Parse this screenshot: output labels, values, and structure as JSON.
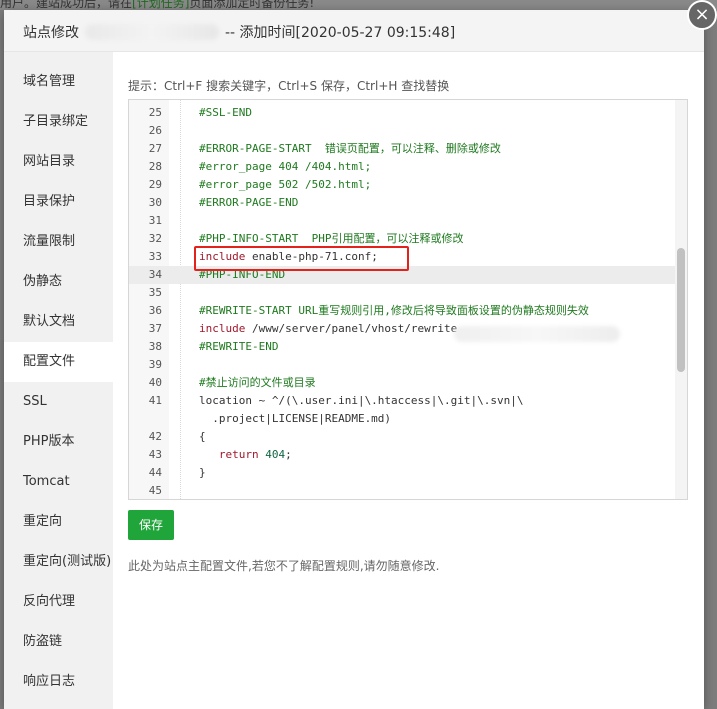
{
  "background": {
    "text_prefix": "用户。建站成功后，请在",
    "text_link": "[计划任务]",
    "text_suffix": "页面添加定时备份任务!"
  },
  "modal": {
    "title_prefix": "站点修改",
    "title_suffix": "-- 添加时间[2020-05-27 09:15:48]",
    "close_icon": "×"
  },
  "sidebar": {
    "items": [
      {
        "label": "域名管理"
      },
      {
        "label": "子目录绑定"
      },
      {
        "label": "网站目录"
      },
      {
        "label": "目录保护"
      },
      {
        "label": "流量限制"
      },
      {
        "label": "伪静态"
      },
      {
        "label": "默认文档"
      },
      {
        "label": "配置文件",
        "active": true
      },
      {
        "label": "SSL"
      },
      {
        "label": "PHP版本"
      },
      {
        "label": "Tomcat"
      },
      {
        "label": "重定向"
      },
      {
        "label": "重定向(测试版)"
      },
      {
        "label": "反向代理"
      },
      {
        "label": "防盗链"
      },
      {
        "label": "响应日志"
      }
    ]
  },
  "content": {
    "tip": "提示：Ctrl+F 搜索关键字，Ctrl+S 保存，Ctrl+H 查找替换",
    "save_label": "保存",
    "note": "此处为站点主配置文件,若您不了解配置规则,请勿随意修改."
  },
  "editor": {
    "lines": [
      {
        "n": "25",
        "parts": [
          {
            "t": "#SSL-END",
            "c": "comment"
          }
        ]
      },
      {
        "n": "26",
        "parts": []
      },
      {
        "n": "27",
        "parts": [
          {
            "t": "#ERROR-PAGE-START  错误页配置，可以注释、删除或修改",
            "c": "comment"
          }
        ]
      },
      {
        "n": "28",
        "parts": [
          {
            "t": "#error_page 404 /404.html;",
            "c": "comment"
          }
        ]
      },
      {
        "n": "29",
        "parts": [
          {
            "t": "#error_page 502 /502.html;",
            "c": "comment"
          }
        ]
      },
      {
        "n": "30",
        "parts": [
          {
            "t": "#ERROR-PAGE-END",
            "c": "comment"
          }
        ]
      },
      {
        "n": "31",
        "parts": []
      },
      {
        "n": "32",
        "parts": [
          {
            "t": "#PHP-INFO-START  PHP引用配置，可以注释或修改",
            "c": "comment"
          }
        ]
      },
      {
        "n": "33",
        "parts": [
          {
            "t": "include",
            "c": "key"
          },
          {
            "t": " enable-php-71.conf;",
            "c": "plain"
          }
        ]
      },
      {
        "n": "34",
        "parts": [
          {
            "t": "#PHP-INFO-END",
            "c": "comment"
          }
        ],
        "active": true
      },
      {
        "n": "35",
        "parts": []
      },
      {
        "n": "36",
        "parts": [
          {
            "t": "#REWRITE-START URL重写规则引用,修改后将导致面板设置的伪静态规则失效",
            "c": "comment"
          }
        ]
      },
      {
        "n": "37",
        "parts": [
          {
            "t": "include",
            "c": "key"
          },
          {
            "t": " /www/server/panel/vhost/rewrite",
            "c": "plain"
          }
        ]
      },
      {
        "n": "38",
        "parts": [
          {
            "t": "#REWRITE-END",
            "c": "comment"
          }
        ]
      },
      {
        "n": "39",
        "parts": []
      },
      {
        "n": "40",
        "parts": [
          {
            "t": "#禁止访问的文件或目录",
            "c": "comment"
          }
        ]
      },
      {
        "n": "41",
        "parts": [
          {
            "t": "location ~ ^/(\\.user.ini|\\.htaccess|\\.git|\\.svn|\\",
            "c": "plain"
          }
        ]
      },
      {
        "n": "",
        "parts": [
          {
            "t": "  .project|LICENSE|README.md)",
            "c": "plain"
          }
        ]
      },
      {
        "n": "42",
        "parts": [
          {
            "t": "{",
            "c": "plain"
          }
        ]
      },
      {
        "n": "43",
        "parts": [
          {
            "t": "   ",
            "c": "plain"
          },
          {
            "t": "return",
            "c": "key"
          },
          {
            "t": " ",
            "c": "plain"
          },
          {
            "t": "404",
            "c": "num"
          },
          {
            "t": ";",
            "c": "plain"
          }
        ]
      },
      {
        "n": "44",
        "parts": [
          {
            "t": "}",
            "c": "plain"
          }
        ]
      },
      {
        "n": "45",
        "parts": []
      }
    ]
  },
  "colors": {
    "save_button": "#20a53a",
    "highlight_box": "#e3231b",
    "comment": "#1f7a1f",
    "keyword": "#a0182b"
  }
}
